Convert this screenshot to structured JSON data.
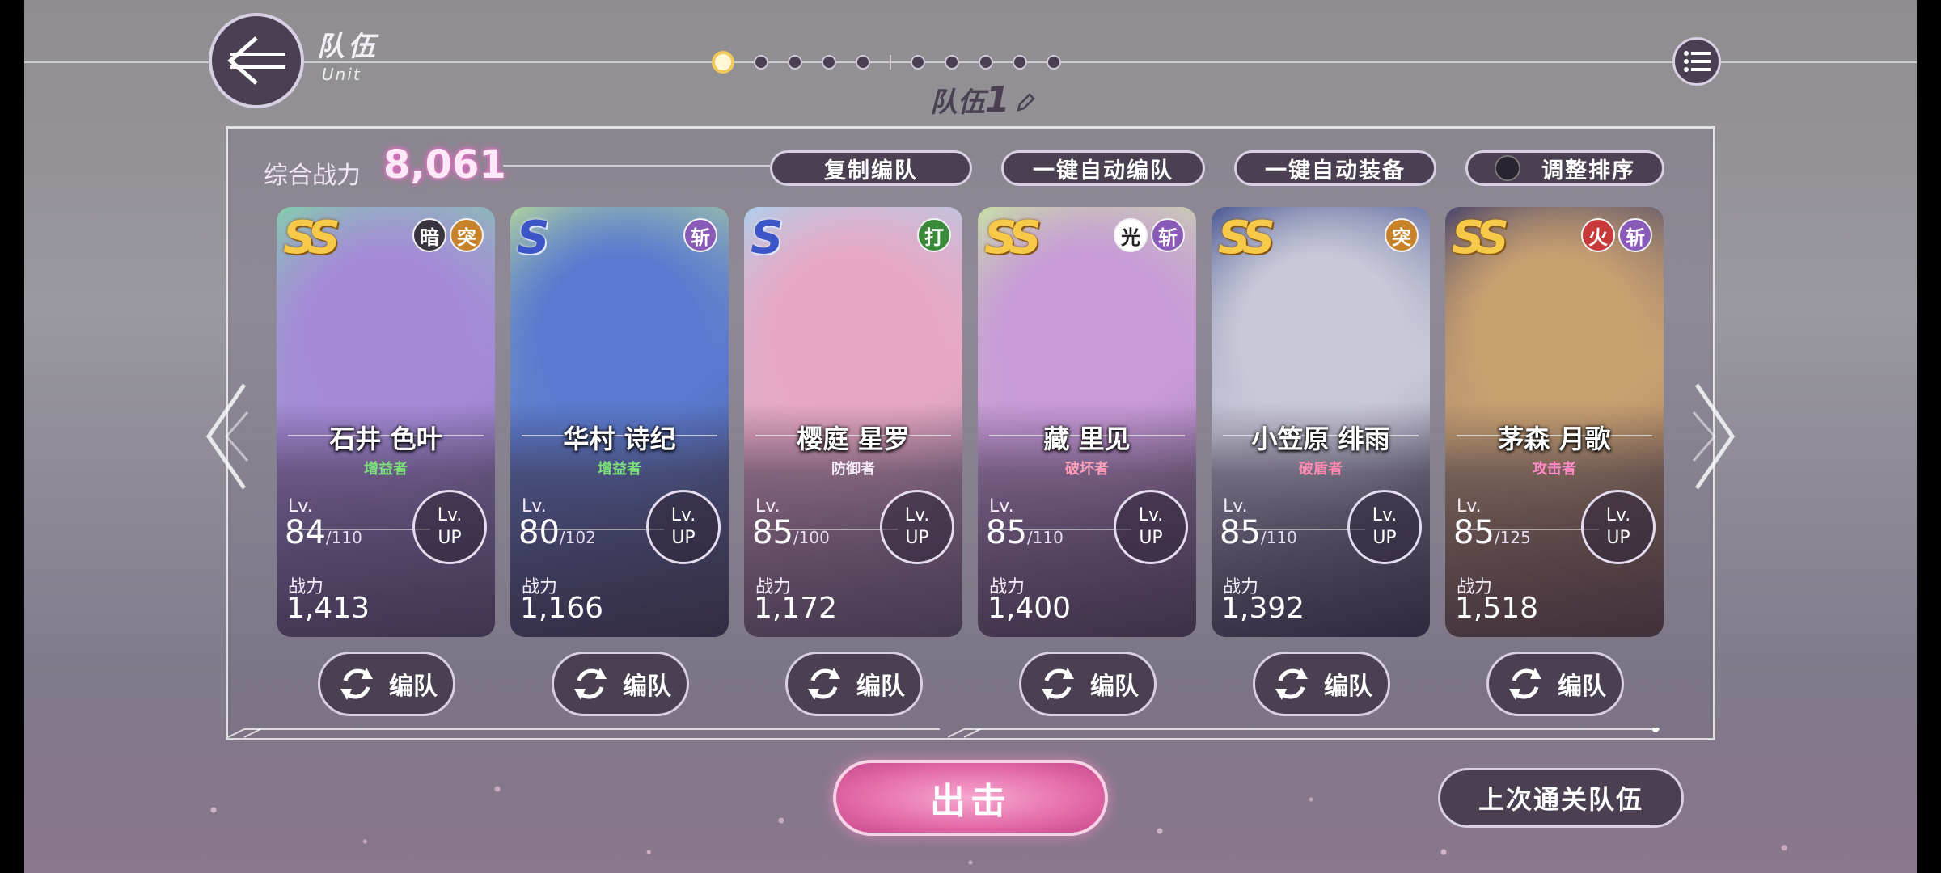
{
  "header": {
    "title_cn": "队伍",
    "title_en": "Unit",
    "team_name_prefix": "队伍",
    "team_number": "1",
    "active_page_index": 0,
    "page_count": 10
  },
  "panel": {
    "power_label": "综合战力",
    "power_value": "8,061",
    "buttons": {
      "copy": "复制编队",
      "auto_form": "一键自动编队",
      "auto_equip": "一键自动装备",
      "sort": "调整排序"
    }
  },
  "cards": [
    {
      "rarity": "SS",
      "attrs": [
        {
          "label": "暗",
          "color": "#3a3440"
        },
        {
          "label": "突",
          "color": "#c8822a"
        }
      ],
      "name": "石井 色叶",
      "role": "增益者",
      "role_color": "#7ce07a",
      "lv_label": "Lv.",
      "level": "84",
      "max_level": "/110",
      "lvup_1": "Lv.",
      "lvup_2": "UP",
      "power_label": "战力",
      "power": "1,413",
      "theme": [
        "#7fd6a8",
        "#a58ad8",
        "#6a5a8a"
      ]
    },
    {
      "rarity": "S",
      "attrs": [
        {
          "label": "斩",
          "color": "#8a5ab8"
        }
      ],
      "name": "华村 诗纪",
      "role": "增益者",
      "role_color": "#7ce07a",
      "lv_label": "Lv.",
      "level": "80",
      "max_level": "/102",
      "lvup_1": "Lv.",
      "lvup_2": "UP",
      "power_label": "战力",
      "power": "1,166",
      "theme": [
        "#b8dd9a",
        "#5a7ad0",
        "#3a3a58"
      ]
    },
    {
      "rarity": "S",
      "attrs": [
        {
          "label": "打",
          "color": "#3a8a3a"
        }
      ],
      "name": "樱庭 星罗",
      "role": "防御者",
      "role_color": "#f4ecf7",
      "lv_label": "Lv.",
      "level": "85",
      "max_level": "/100",
      "lvup_1": "Lv.",
      "lvup_2": "UP",
      "power_label": "战力",
      "power": "1,172",
      "theme": [
        "#a8d4ef",
        "#e8a8c4",
        "#7a6a88"
      ]
    },
    {
      "rarity": "SS",
      "attrs": [
        {
          "label": "光",
          "color": "#ffffff"
        },
        {
          "label": "斩",
          "color": "#8a5ab8"
        }
      ],
      "name": "藏 里见",
      "role": "破坏者",
      "role_color": "#ffa0b8",
      "lv_label": "Lv.",
      "level": "85",
      "max_level": "/110",
      "lvup_1": "Lv.",
      "lvup_2": "UP",
      "power_label": "战力",
      "power": "1,400",
      "theme": [
        "#c8e8a0",
        "#c89ad8",
        "#5a4a6a"
      ]
    },
    {
      "rarity": "SS",
      "attrs": [
        {
          "label": "突",
          "color": "#c8822a"
        }
      ],
      "name": "小笠原 绯雨",
      "role": "破盾者",
      "role_color": "#ff8ab0",
      "lv_label": "Lv.",
      "level": "85",
      "max_level": "/110",
      "lvup_1": "Lv.",
      "lvup_2": "UP",
      "power_label": "战力",
      "power": "1,392",
      "theme": [
        "#3a4a8a",
        "#c8c8d8",
        "#2a2a48"
      ]
    },
    {
      "rarity": "SS",
      "attrs": [
        {
          "label": "火",
          "color": "#c83a3a"
        },
        {
          "label": "斩",
          "color": "#8a5ab8"
        }
      ],
      "name": "茅森 月歌",
      "role": "攻击者",
      "role_color": "#ff8ac8",
      "lv_label": "Lv.",
      "level": "85",
      "max_level": "/125",
      "lvup_1": "Lv.",
      "lvup_2": "UP",
      "power_label": "战力",
      "power": "1,518",
      "theme": [
        "#3a3a6a",
        "#c8a070",
        "#6a4a3a"
      ]
    }
  ],
  "formation_label": "编队",
  "bottom": {
    "sortie": "出击",
    "last_team": "上次通关队伍"
  },
  "colors": {
    "accent": "#e36aa8",
    "button_bg": "#4a4052",
    "gold": "#f7c948"
  }
}
